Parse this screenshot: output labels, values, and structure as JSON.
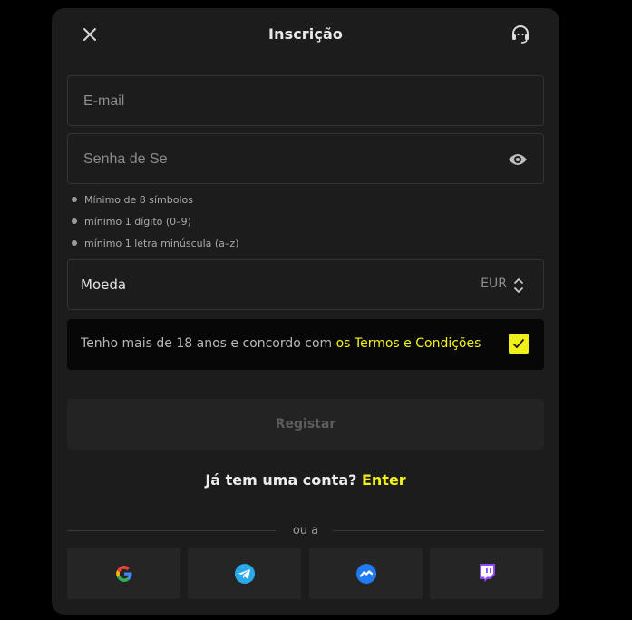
{
  "header": {
    "title": "Inscrição"
  },
  "form": {
    "email_placeholder": "E-mail",
    "password_placeholder": "Senha de Se",
    "password_rules": [
      "Mínimo de 8 símbolos",
      "mínimo 1 dígito (0–9)",
      "mínimo 1 letra minúscula (a–z)"
    ],
    "currency_label": "Moeda",
    "currency_value": "EUR",
    "terms_text": "Tenho mais de 18 anos e concordo com ",
    "terms_link": "os Termos e Condições",
    "terms_checked": true,
    "register_label": "Registar"
  },
  "login": {
    "prompt": "Já tem uma conta? ",
    "link": "Enter"
  },
  "divider": {
    "text": "ou a"
  },
  "socials": [
    {
      "name": "google",
      "icon": "google-icon"
    },
    {
      "name": "telegram",
      "icon": "telegram-icon"
    },
    {
      "name": "messenger",
      "icon": "messenger-icon"
    },
    {
      "name": "twitch",
      "icon": "twitch-icon"
    }
  ],
  "colors": {
    "accent": "#f4f21b",
    "background": "#000000",
    "modal": "#1c1c1c"
  }
}
